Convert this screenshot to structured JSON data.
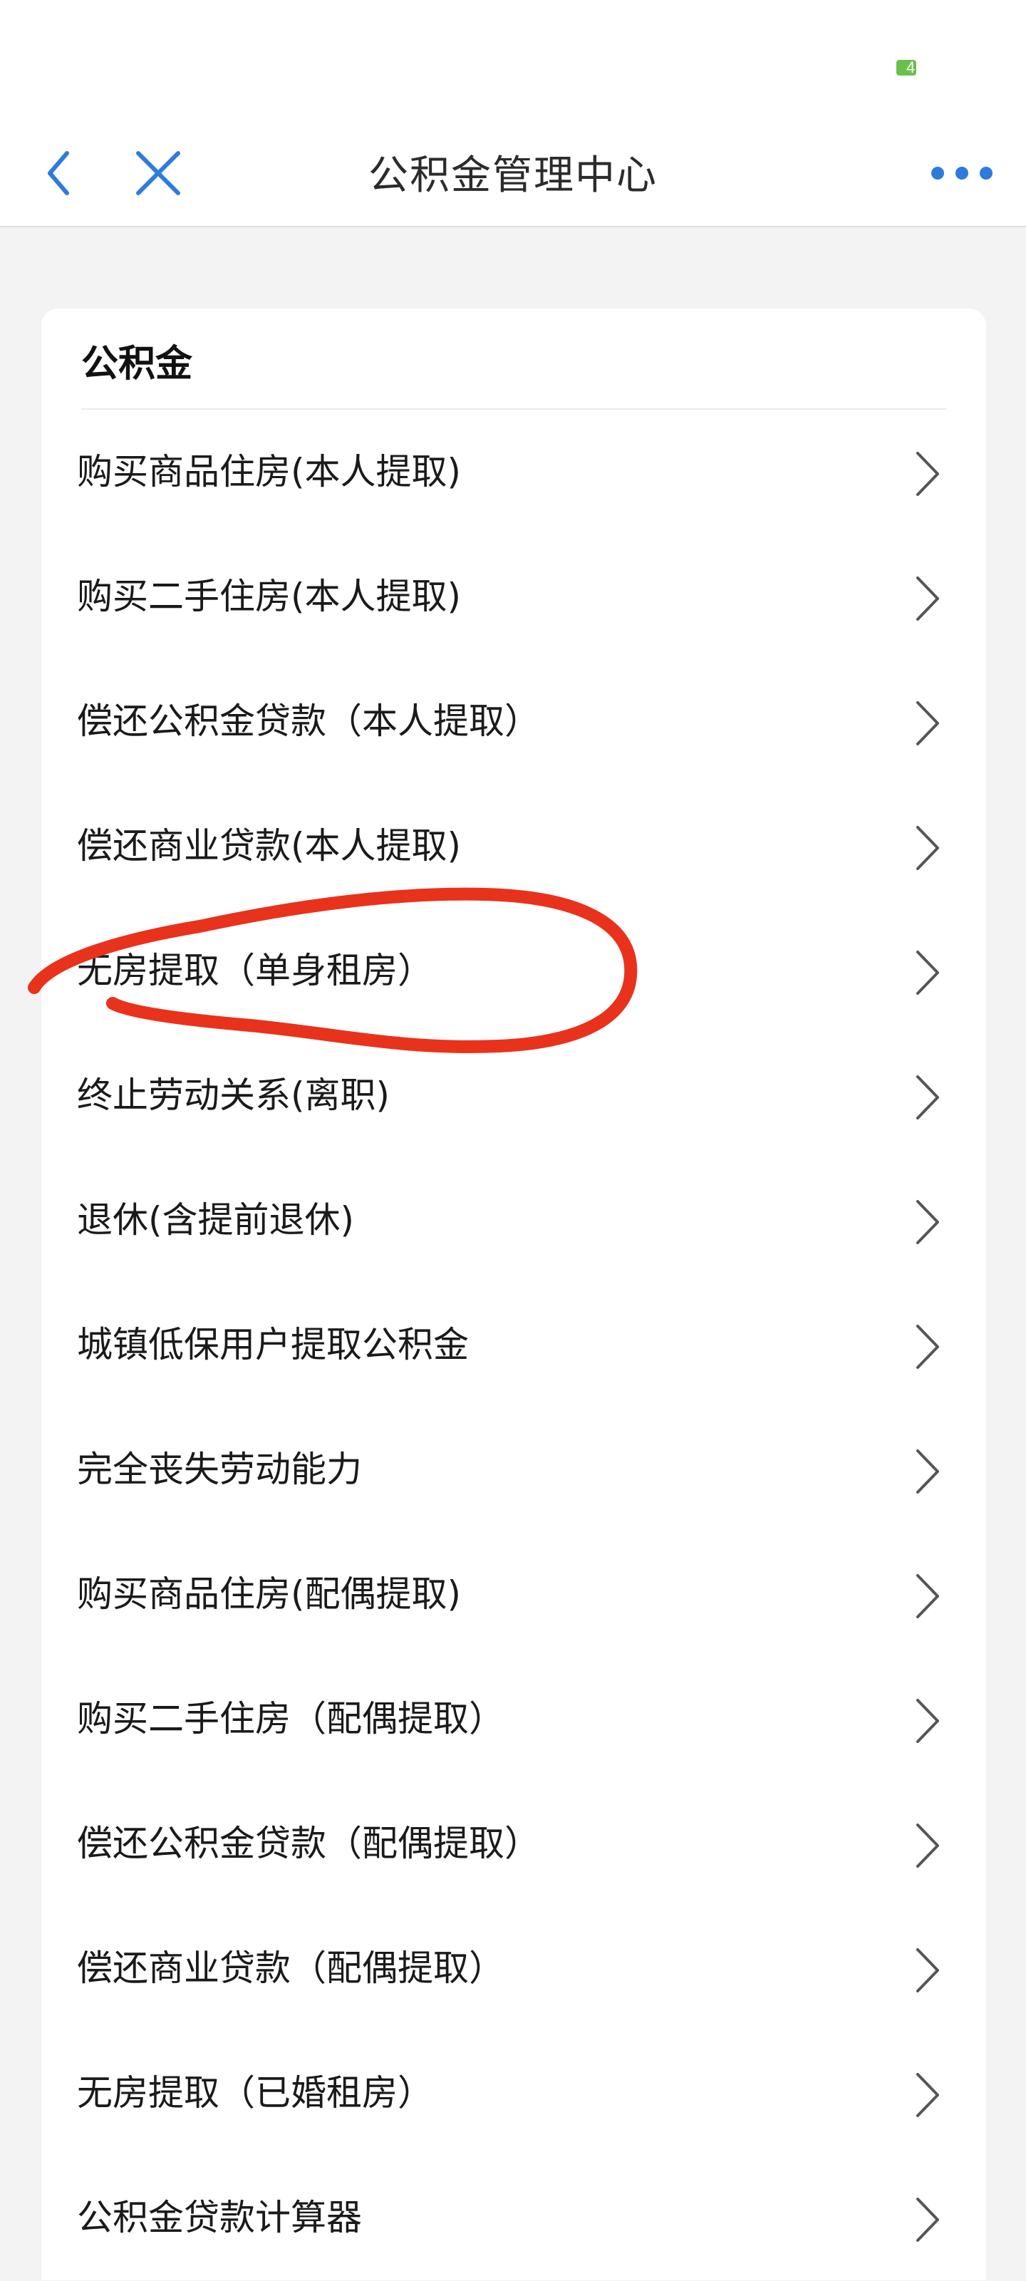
{
  "status_bar": {
    "battery_level": "4",
    "battery_color": "#6ac14a"
  },
  "nav": {
    "title": "公积金管理中心",
    "back_icon": "chevron-left-icon",
    "close_icon": "close-icon",
    "more_icon": "more-dots-icon",
    "accent_color": "#2e7bdc"
  },
  "card": {
    "section_title": "公积金",
    "items": [
      {
        "label": "购买商品住房(本人提取)"
      },
      {
        "label": "购买二手住房(本人提取)"
      },
      {
        "label": "偿还公积金贷款（本人提取）"
      },
      {
        "label": "偿还商业贷款(本人提取)"
      },
      {
        "label": "无房提取（单身租房）"
      },
      {
        "label": "终止劳动关系(离职)"
      },
      {
        "label": "退休(含提前退休)"
      },
      {
        "label": "城镇低保用户提取公积金"
      },
      {
        "label": "完全丧失劳动能力"
      },
      {
        "label": "购买商品住房(配偶提取)"
      },
      {
        "label": "购买二手住房（配偶提取）"
      },
      {
        "label": "偿还公积金贷款（配偶提取）"
      },
      {
        "label": "偿还商业贷款（配偶提取）"
      },
      {
        "label": "无房提取（已婚租房）"
      },
      {
        "label": "公积金贷款计算器"
      }
    ],
    "chevron_icon": "chevron-right-icon"
  },
  "annotation": {
    "description_color": "#e8321c",
    "circled_item_index": 4
  }
}
